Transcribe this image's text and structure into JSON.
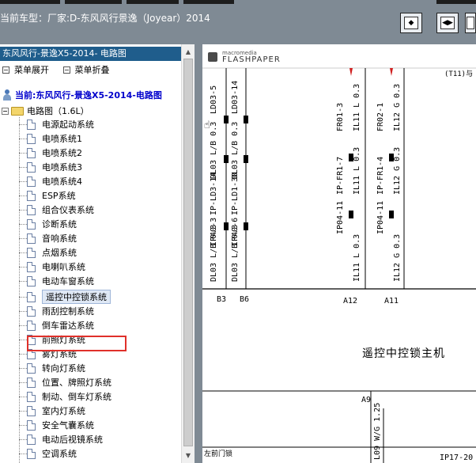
{
  "header": {
    "title": "当前车型：厂家:D-东风风行景逸（Joyear）2014",
    "buttons": [
      "fit-page",
      "fit-width",
      "next-view"
    ]
  },
  "sidebar": {
    "title": "东风风行-景逸X5-2014- 电路图",
    "expand_label": "菜单展开",
    "collapse_label": "菜单折叠",
    "current_label": "当前:东风风行-景逸X5-2014-电路图",
    "root_label": "电路图（1.6L）",
    "items": [
      "电源起动系统",
      "电喷系统1",
      "电喷系统2",
      "电喷系统3",
      "电喷系统4",
      "ESP系统",
      "组合仪表系统",
      "诊断系统",
      "音响系统",
      "点烟系统",
      "电喇叭系统",
      "电动车窗系统",
      "遥控中控锁系统",
      "雨刮控制系统",
      "倒车雷达系统",
      "前照灯系统",
      "雾灯系统",
      "转向灯系统",
      "位置、牌照灯系统",
      "制动、倒车灯系统",
      "室内灯系统",
      "安全气囊系统",
      "电动后视镜系统",
      "空调系统"
    ],
    "selected_index": 12
  },
  "viewer": {
    "brand_small": "macromedia",
    "brand_big": "FLASHPAPER",
    "module_label": "遥控中控锁主机",
    "wires_left": [
      {
        "connector": "IP-LD3-14",
        "top_code": "LD03-5",
        "text": "DL03 L/B 0.3"
      },
      {
        "connector": "IP-LD1-30",
        "top_code": "LD03-14",
        "text": "DL03 L/B 0.3"
      }
    ],
    "pin_labels": [
      "B3",
      "B6",
      "A12",
      "A11",
      "A9"
    ],
    "wires_right": [
      {
        "code": "FR01-3",
        "connector": "IP-FR1-7",
        "text": "IL11 L 0.3"
      },
      {
        "code": "FR02-1",
        "connector": "IP-FR1-4",
        "text": "IL12 G 0.3"
      }
    ],
    "bottom_codes": [
      "IP40-3",
      "IP40-6",
      "IP04-11",
      "IP04-11",
      "IP17-20"
    ],
    "bottom_left_text": "左前门锁",
    "bottom_wire": "L09 W/G 1.25",
    "corner_text": "(T11)与"
  }
}
